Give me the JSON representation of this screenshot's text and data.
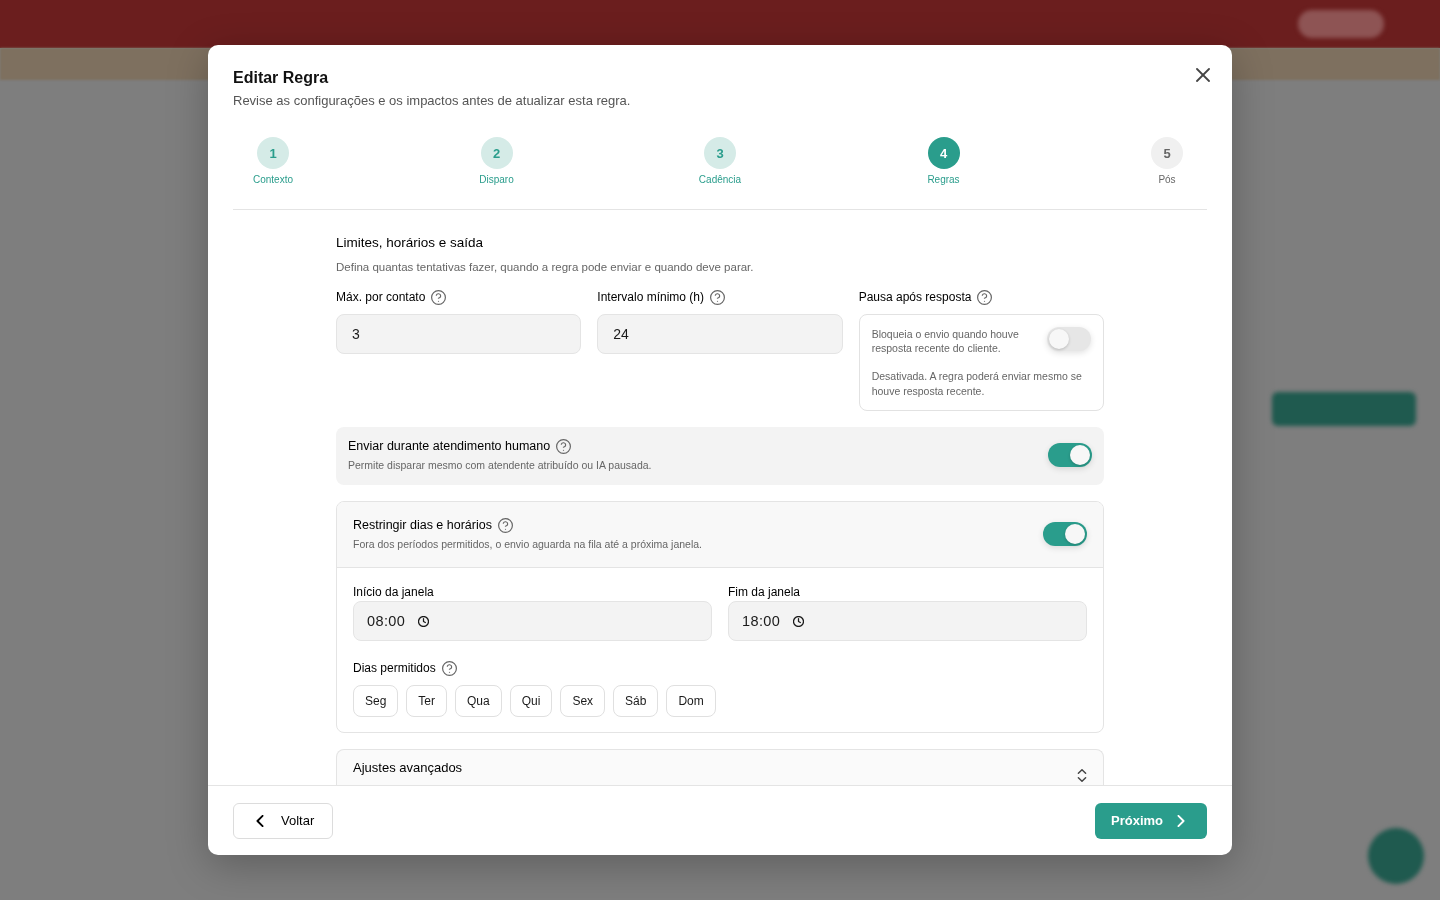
{
  "dialog": {
    "title": "Editar Regra",
    "subtitle": "Revise as configurações e os impactos antes de atualizar esta regra."
  },
  "steps": [
    {
      "number": "1",
      "label": "Contexto",
      "done": true,
      "selected": false
    },
    {
      "number": "2",
      "label": "Disparo",
      "done": true,
      "selected": false
    },
    {
      "number": "3",
      "label": "Cadência",
      "done": true,
      "selected": false
    },
    {
      "number": "4",
      "label": "Regras",
      "done": false,
      "selected": true
    },
    {
      "number": "5",
      "label": "Pós",
      "done": false,
      "selected": false
    }
  ],
  "section": {
    "title": "Limites, horários e saída",
    "description": "Defina quantas tentativas fazer, quando a regra pode enviar e quando deve parar."
  },
  "fields": [
    {
      "label": "Máx. por contato",
      "value": "3"
    },
    {
      "label": "Intervalo mínimo (h)",
      "value": "24"
    }
  ],
  "pause_after_reply": {
    "label": "Pausa após resposta",
    "description": "Bloqueia o envio quando houve resposta recente do cliente.",
    "on": false,
    "status_text": "Desativada. A regra poderá enviar mesmo se houve resposta recente."
  },
  "human_handoff": {
    "title": "Enviar durante atendimento humano",
    "description": "Permite disparar mesmo com atendente atribuído ou IA pausada.",
    "on": true
  },
  "schedule": {
    "title": "Restringir dias e horários",
    "description": "Fora dos períodos permitidos, o envio aguarda na fila até a próxima janela.",
    "on": true,
    "start": {
      "label": "Início da janela",
      "value": "08:00"
    },
    "end": {
      "label": "Fim da janela",
      "value": "18:00"
    },
    "days_label": "Dias permitidos",
    "days": [
      {
        "label": "Seg",
        "selected": false
      },
      {
        "label": "Ter",
        "selected": false
      },
      {
        "label": "Qua",
        "selected": false
      },
      {
        "label": "Qui",
        "selected": false
      },
      {
        "label": "Sex",
        "selected": false
      },
      {
        "label": "Sáb",
        "selected": false
      },
      {
        "label": "Dom",
        "selected": false
      }
    ]
  },
  "advanced": {
    "title": "Ajustes avançados"
  },
  "footer": {
    "back": "Voltar",
    "next": "Próximo"
  }
}
